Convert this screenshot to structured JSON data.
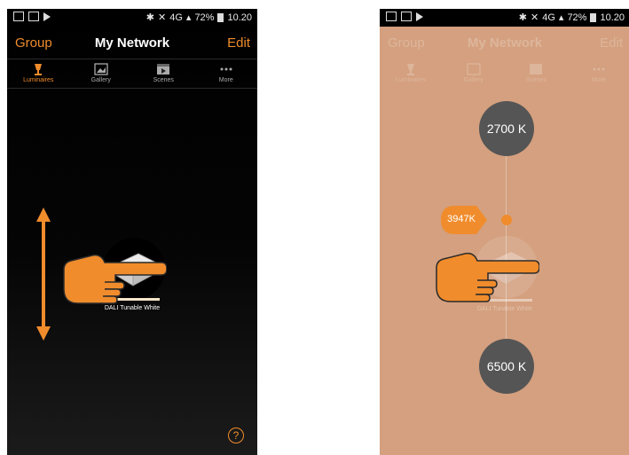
{
  "status_bar": {
    "battery_text": "72%",
    "time": "10.20",
    "network_text": "4G"
  },
  "nav": {
    "group_label": "Group",
    "title": "My Network",
    "edit_label": "Edit"
  },
  "tabs": [
    {
      "label": "Luminaires",
      "icon": "lamp-icon",
      "active": true
    },
    {
      "label": "Gallery",
      "icon": "gallery-icon",
      "active": false
    },
    {
      "label": "Scenes",
      "icon": "scenes-icon",
      "active": false
    },
    {
      "label": "More",
      "icon": "more-icon",
      "active": false
    }
  ],
  "device": {
    "name": "DALI Tunable White"
  },
  "help_label": "?",
  "color_temp": {
    "min_label": "2700 K",
    "max_label": "6500 K",
    "current_label": "3947K"
  },
  "colors": {
    "accent": "#f08c2c",
    "overlay": "#d4a07f",
    "circle": "#555555"
  }
}
